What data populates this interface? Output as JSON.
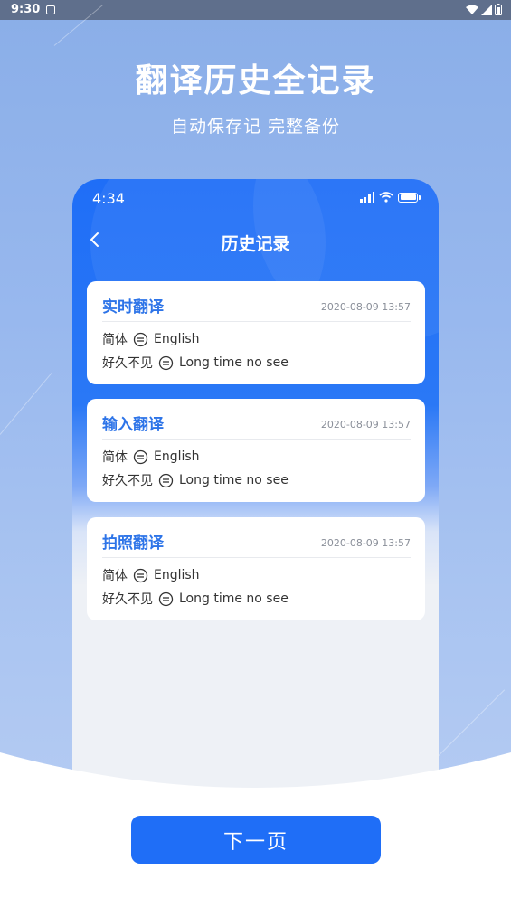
{
  "system_status": {
    "time": "9:30"
  },
  "hero": {
    "title": "翻译历史全记录",
    "subtitle": "自动保存记 完整备份"
  },
  "phone": {
    "status_time": "4:34",
    "nav_title": "历史记录",
    "cards": [
      {
        "title": "实时翻译",
        "time": "2020-08-09 13:57",
        "source_lang": "简体",
        "target_lang": "English",
        "source_text": "好久不见",
        "target_text": "Long time no see"
      },
      {
        "title": "输入翻译",
        "time": "2020-08-09 13:57",
        "source_lang": "简体",
        "target_lang": "English",
        "source_text": "好久不见",
        "target_text": "Long time no see"
      },
      {
        "title": "拍照翻译",
        "time": "2020-08-09 13:57",
        "source_lang": "简体",
        "target_lang": "English",
        "source_text": "好久不见",
        "target_text": "Long time no see"
      }
    ]
  },
  "footer": {
    "next_label": "下一页"
  },
  "colors": {
    "accent": "#1f6ef7",
    "card_title": "#2d74e8",
    "background_top": "#8aaee8",
    "status_bar": "#5f6f8c"
  },
  "icons": [
    "back-arrow-icon",
    "wifi-icon",
    "signal-icon",
    "battery-icon",
    "equivalence-icon"
  ]
}
